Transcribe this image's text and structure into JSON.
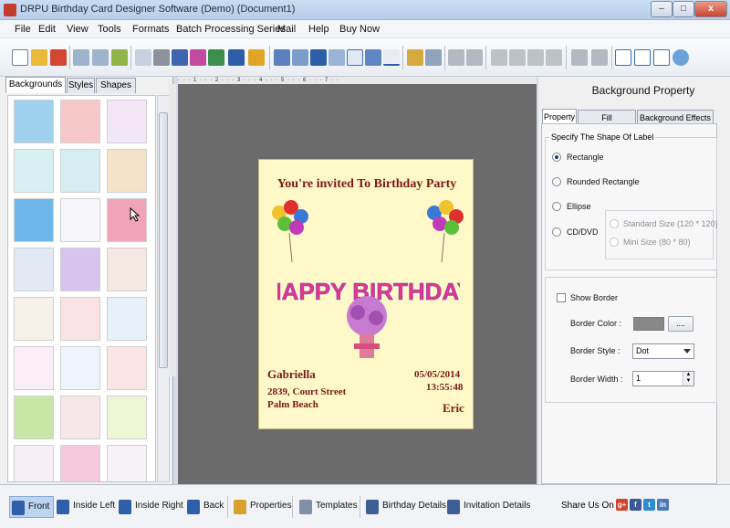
{
  "window": {
    "title": "DRPU Birthday Card Designer Software (Demo) (Document1)",
    "minimize": "–",
    "maximize": "□",
    "close": "x"
  },
  "menu": [
    "File",
    "Edit",
    "View",
    "Tools",
    "Formats",
    "Batch Processing Series",
    "Mail",
    "Help",
    "Buy Now"
  ],
  "left_panel": {
    "tabs": [
      "Backgrounds",
      "Styles",
      "Shapes"
    ],
    "active_tab": "Backgrounds"
  },
  "ruler": {
    "marks": "· · · 1 · · · 2 · · · 3 · · · 4 · · · 5 · · · 6 · · · 7 · ·"
  },
  "card": {
    "title": "You're invited To Birthday Party",
    "banner": "HAPPY BIRTHDAY",
    "name": "Gabriella",
    "address_line1": "2839, Court Street",
    "address_line2": "Palm Beach",
    "date": "05/05/2014",
    "time": "13:55:48",
    "signature": "Eric"
  },
  "right_panel": {
    "title": "Background Property",
    "tabs": [
      "Property",
      "Fill Background",
      "Background Effects"
    ],
    "shape_group_label": "Specify The Shape Of Label",
    "shapes": [
      "Rectangle",
      "Rounded Rectangle",
      "Ellipse",
      "CD/DVD"
    ],
    "selected_shape": "Rectangle",
    "cd_sizes": [
      "Standard Size (120 * 120)",
      "Mini Size (80 * 80)"
    ],
    "show_border": "Show Border",
    "border_color_label": "Border Color :",
    "border_color_btn": "....",
    "border_style_label": "Border Style :",
    "border_style_value": "Dot",
    "border_width_label": "Border Width :",
    "border_width_value": "1"
  },
  "bottom": {
    "buttons": [
      "Front",
      "Inside Left",
      "Inside Right",
      "Back",
      "Properties",
      "Templates",
      "Birthday Details",
      "Invitation Details"
    ],
    "active": "Front",
    "share_label": "Share Us On :",
    "social": [
      "g+",
      "f",
      "t",
      "in"
    ]
  }
}
